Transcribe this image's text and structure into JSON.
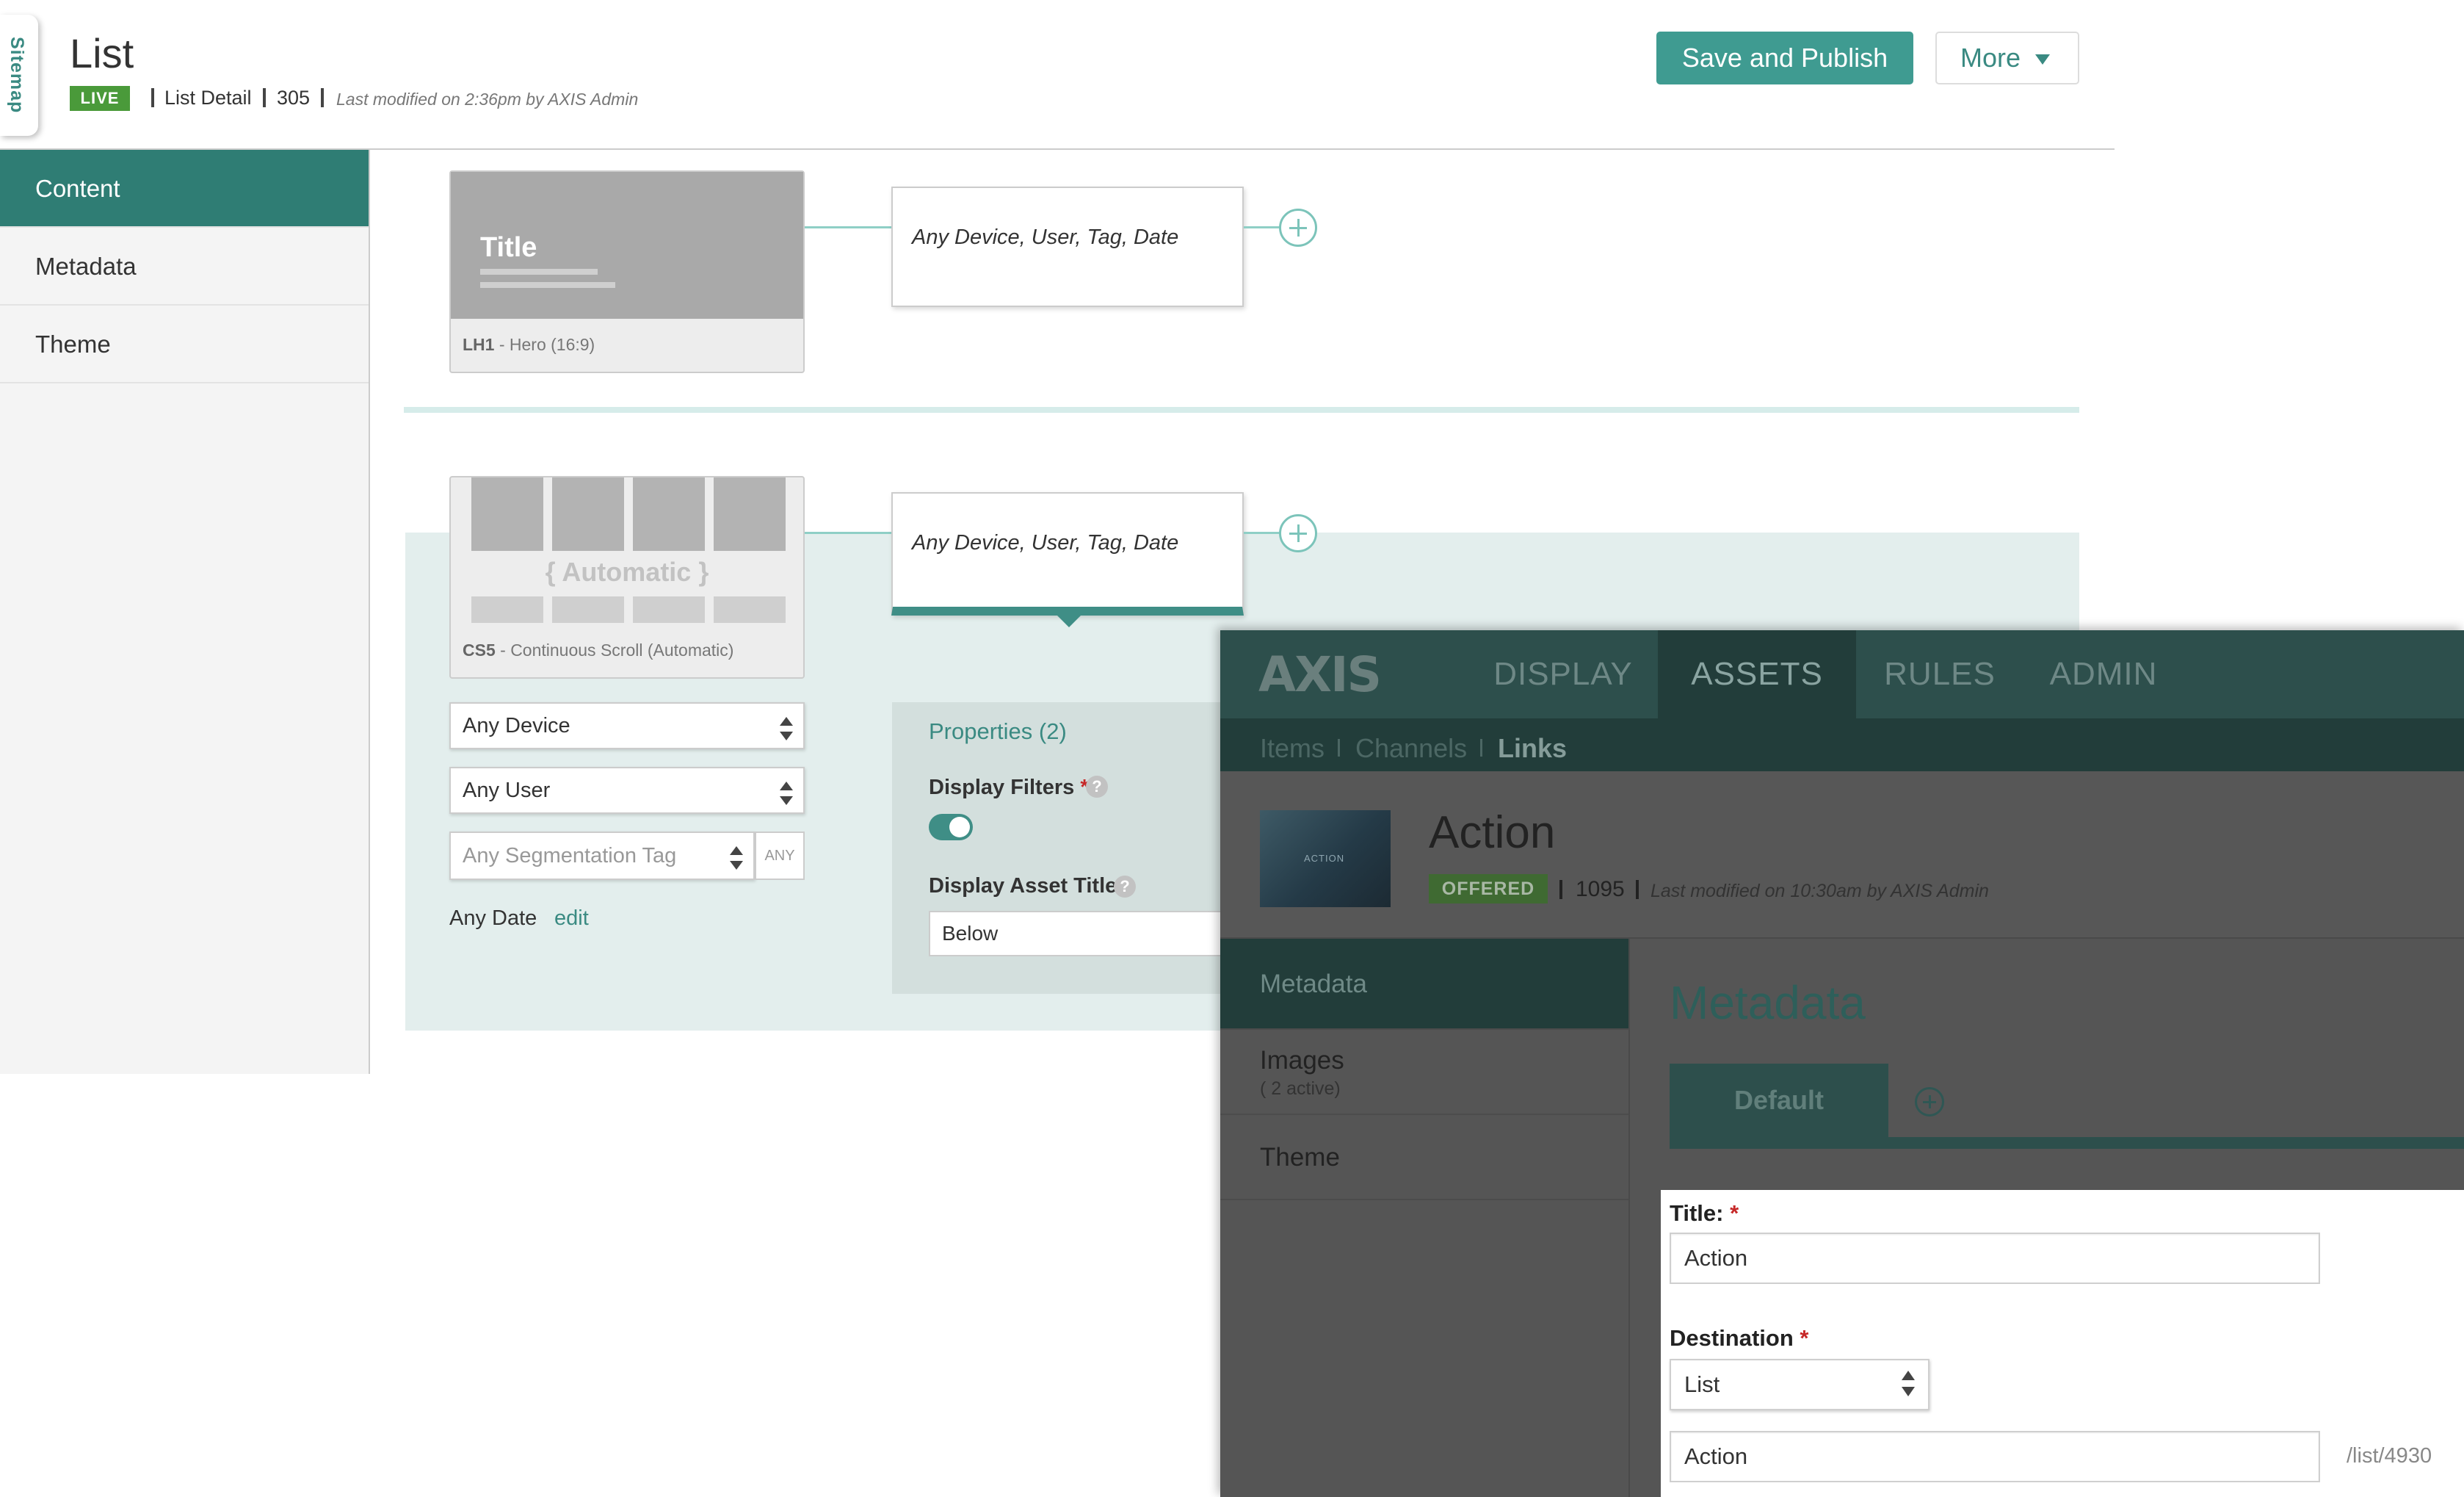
{
  "header": {
    "sitemap_label": "Sitemap",
    "title": "List",
    "status": "LIVE",
    "page_type": "List Detail",
    "page_id": "305",
    "last_modified": "Last modified on 2:36pm by AXIS Admin",
    "save_label": "Save and Publish",
    "more_label": "More"
  },
  "sidebar": {
    "items": [
      {
        "label": "Content",
        "active": true
      },
      {
        "label": "Metadata",
        "active": false
      },
      {
        "label": "Theme",
        "active": false
      }
    ]
  },
  "rows": [
    {
      "thumb_title": "Title",
      "caption_code": "LH1",
      "caption_name": " - Hero (16:9)",
      "rule": "Any Device, User, Tag, Date"
    },
    {
      "thumb_title": "{ Automatic }",
      "caption_code": "CS5",
      "caption_name": " - Continuous Scroll (Automatic)",
      "rule": "Any Device, User, Tag, Date",
      "device": "Any Device",
      "user": "Any User",
      "segment_placeholder": "Any Segmentation Tag",
      "segment_any": "ANY",
      "date": "Any Date",
      "date_edit": "edit",
      "properties": {
        "heading": "Properties (2)",
        "display_filters_label": "Display Filters",
        "display_filters_on": true,
        "display_asset_title_label": "Display Asset Title",
        "display_asset_title_value": "Below"
      }
    }
  ],
  "axis": {
    "logo": "AXIS",
    "nav": [
      {
        "label": "DISPLAY",
        "active": false
      },
      {
        "label": "ASSETS",
        "active": true
      },
      {
        "label": "RULES",
        "active": false
      },
      {
        "label": "ADMIN",
        "active": false
      }
    ],
    "subnav": [
      {
        "label": "Items",
        "active": false
      },
      {
        "label": "Channels",
        "active": false
      },
      {
        "label": "Links",
        "active": true
      }
    ],
    "asset": {
      "thumb_text": "ACTION",
      "title": "Action",
      "status": "OFFERED",
      "id": "1095",
      "last_modified": "Last modified on 10:30am by AXIS Admin"
    },
    "sidebar": [
      {
        "label": "Metadata",
        "sub": "",
        "active": true
      },
      {
        "label": "Images",
        "sub": "( 2 active)",
        "active": false
      },
      {
        "label": "Theme",
        "sub": "",
        "active": false
      }
    ],
    "section_title": "Metadata",
    "tab_default": "Default",
    "form": {
      "title_label": "Title:",
      "title_value": "Action",
      "destination_label": "Destination",
      "destination_type": "List",
      "destination_value": "Action",
      "destination_path": "/list/4930",
      "required_mark": "*"
    }
  }
}
